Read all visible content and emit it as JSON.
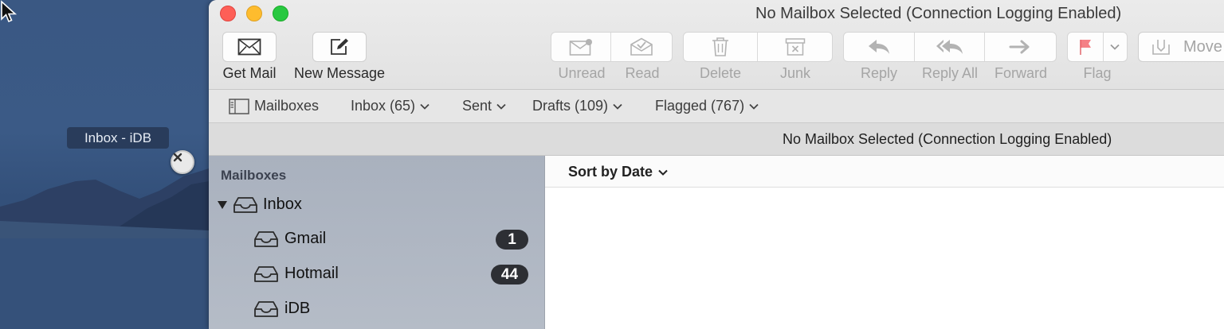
{
  "desktop": {
    "drag_label": "Inbox - iDB"
  },
  "window": {
    "title": "No Mailbox Selected (Connection Logging Enabled)"
  },
  "toolbar": {
    "get_mail": "Get Mail",
    "new_message": "New Message",
    "unread": "Unread",
    "read": "Read",
    "delete": "Delete",
    "junk": "Junk",
    "reply": "Reply",
    "reply_all": "Reply All",
    "forward": "Forward",
    "flag": "Flag",
    "move_partial": "Move"
  },
  "favorites": {
    "mailboxes": "Mailboxes",
    "inbox": "Inbox (65)",
    "sent": "Sent",
    "drafts": "Drafts (109)",
    "flagged": "Flagged (767)"
  },
  "infobar": {
    "text": "No Mailbox Selected (Connection Logging Enabled)"
  },
  "sidebar": {
    "heading": "Mailboxes",
    "inbox": "Inbox",
    "accounts": [
      {
        "label": "Gmail",
        "count": "1"
      },
      {
        "label": "Hotmail",
        "count": "44"
      },
      {
        "label": "iDB",
        "count": ""
      }
    ]
  },
  "message_list": {
    "sort_label": "Sort by Date"
  },
  "colors": {
    "flag": "#f0555d",
    "badge": "#2d2f34",
    "close_red": "#fe5f57",
    "minimize_yellow": "#febc2e",
    "zoom_green": "#28c840"
  }
}
